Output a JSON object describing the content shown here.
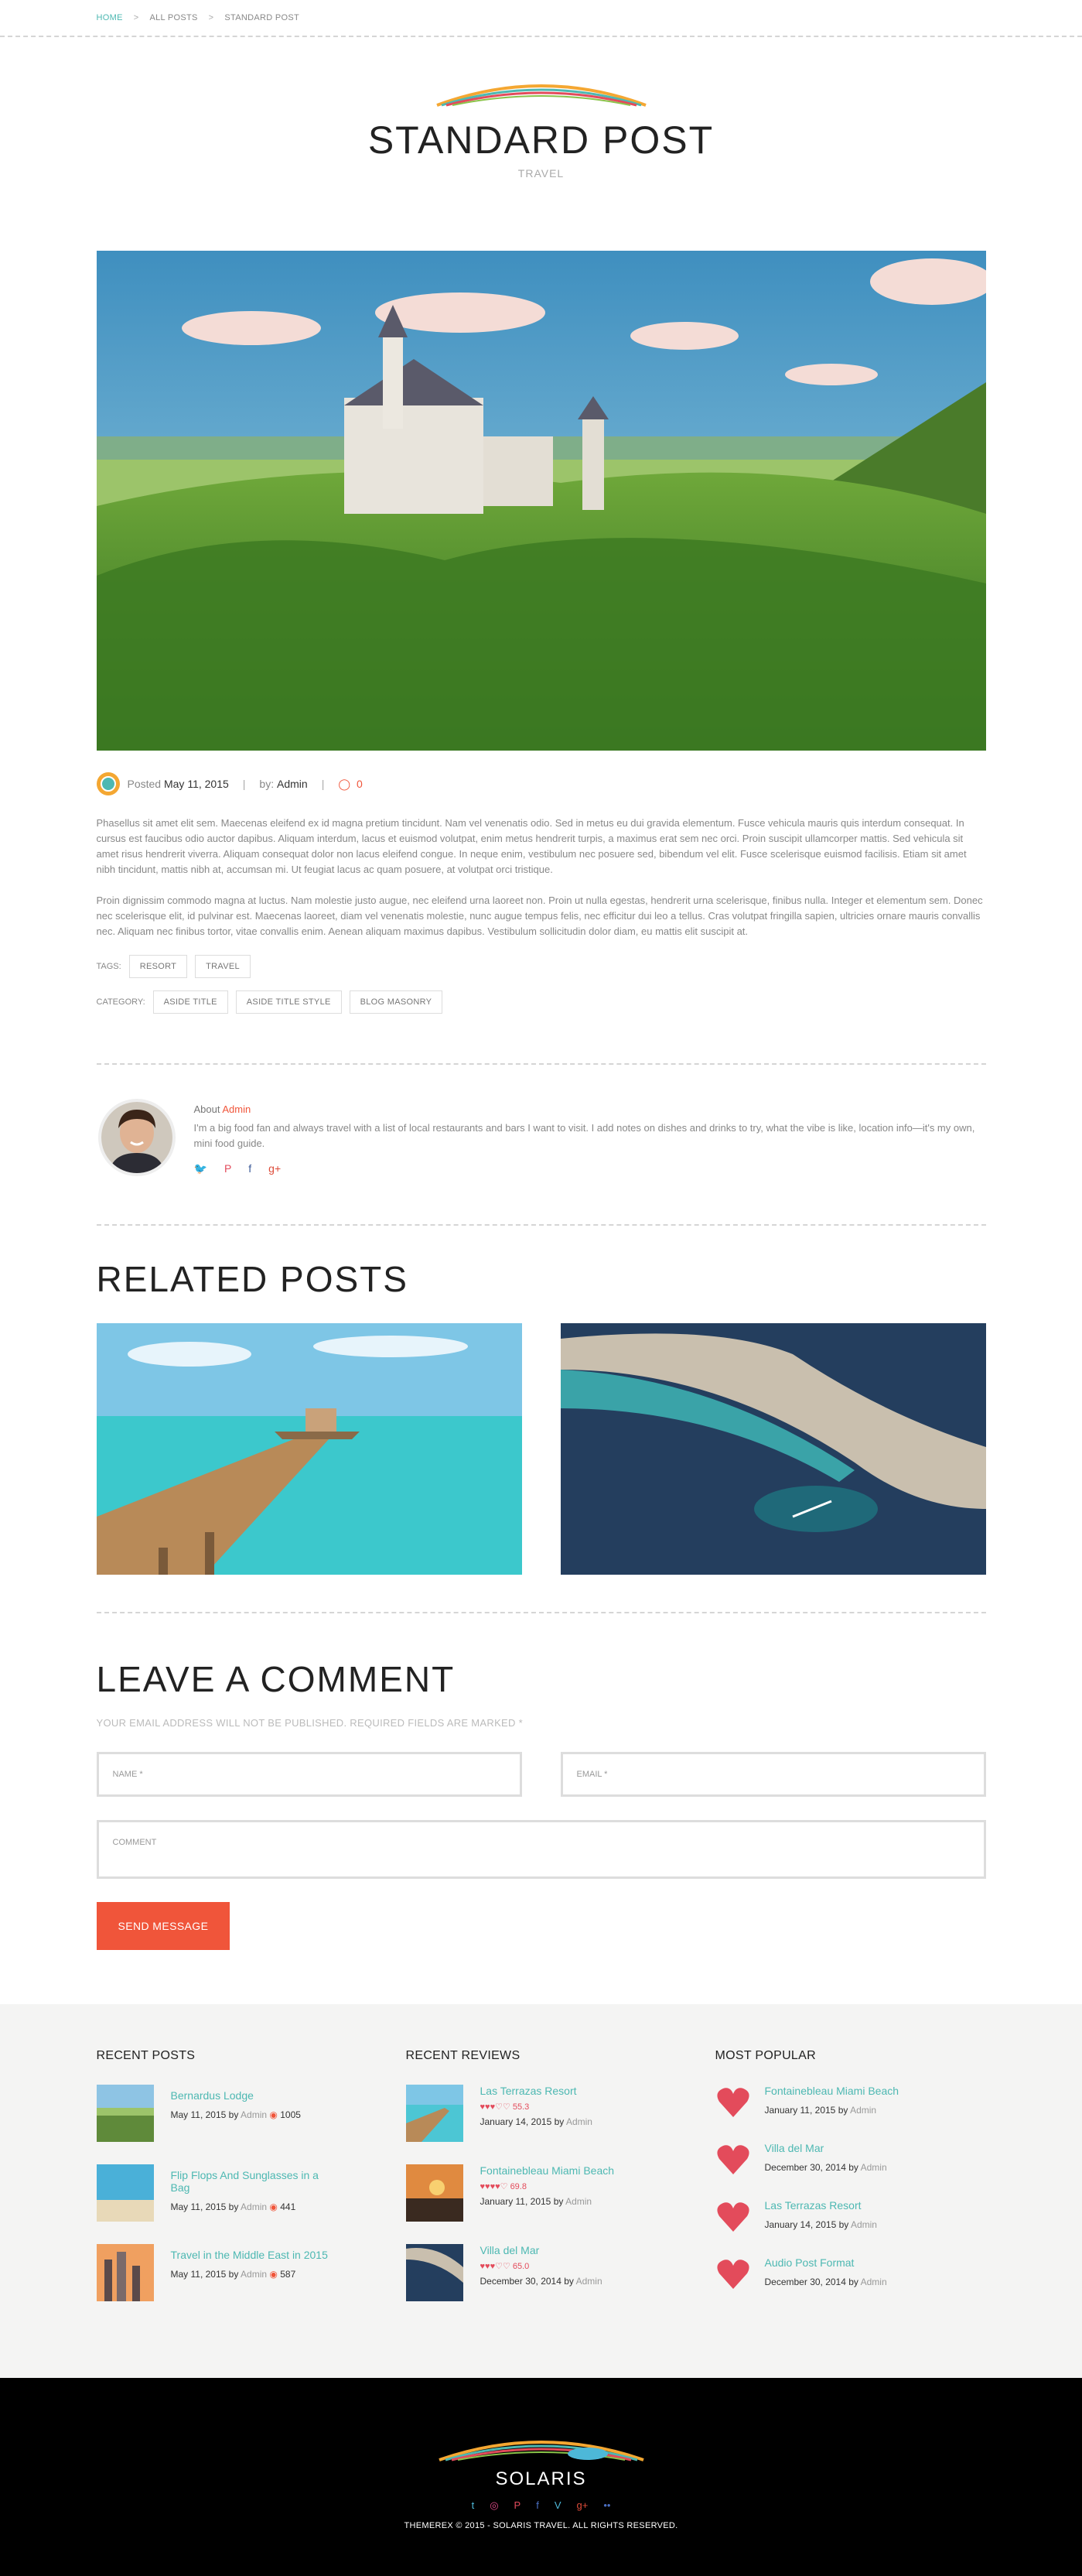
{
  "breadcrumb": {
    "home": "HOME",
    "sep1": ">",
    "all_posts": "ALL POSTS",
    "sep2": ">",
    "current": "STANDARD POST"
  },
  "post": {
    "title": "STANDARD POST",
    "category": "TRAVEL",
    "posted_label": "Posted",
    "date": "May 11, 2015",
    "by_label": "by:",
    "author": "Admin",
    "comments": "0",
    "separator": "|",
    "paragraphs": [
      "Phasellus sit amet elit sem. Maecenas eleifend ex id magna pretium tincidunt. Nam vel venenatis odio. Sed in metus eu dui gravida elementum. Fusce vehicula mauris quis interdum consequat. In cursus est faucibus odio auctor dapibus. Aliquam interdum, lacus et euismod volutpat, enim metus hendrerit turpis, a maximus erat sem nec orci. Proin suscipit ullamcorper mattis. Sed vehicula sit amet risus hendrerit viverra. Aliquam consequat dolor non lacus eleifend congue. In neque enim, vestibulum nec posuere sed, bibendum vel elit. Fusce scelerisque euismod facilisis. Etiam sit amet nibh tincidunt, mattis nibh at, accumsan mi. Ut feugiat lacus ac quam posuere, at volutpat orci tristique.",
      "Proin dignissim commodo magna at luctus. Nam molestie justo augue, nec eleifend urna laoreet non. Proin ut nulla egestas, hendrerit urna scelerisque, finibus nulla. Integer et elementum sem. Donec nec scelerisque elit, id pulvinar est. Maecenas laoreet, diam vel venenatis molestie, nunc augue tempus felis, nec efficitur dui leo a tellus. Cras volutpat fringilla sapien, ultricies ornare mauris convallis nec. Aliquam nec finibus tortor, vitae convallis enim. Aenean aliquam maximus dapibus. Vestibulum sollicitudin dolor diam, eu mattis elit suscipit at."
    ],
    "tags_label": "TAGS:",
    "tags": [
      "RESORT",
      "TRAVEL"
    ],
    "category_label": "CATEGORY:",
    "categories": [
      "ASIDE TITLE",
      "ASIDE TITLE STYLE",
      "BLOG MASONRY"
    ]
  },
  "author_box": {
    "about_label": "About",
    "name": "Admin",
    "bio": "I'm a big food fan and always travel with a list of local restaurants and bars I want to visit. I add notes on dishes and drinks to try, what the vibe is like, location info—it's my own, mini food guide.",
    "social": [
      {
        "icon": "twitter-icon",
        "glyph": "🐦",
        "color": "#4db8d8"
      },
      {
        "icon": "pinterest-icon",
        "glyph": "P",
        "color": "#e34b5b"
      },
      {
        "icon": "facebook-icon",
        "glyph": "f",
        "color": "#3b5998"
      },
      {
        "icon": "google-plus-icon",
        "glyph": "g+",
        "color": "#dd4b39"
      }
    ]
  },
  "related": {
    "heading": "RELATED POSTS"
  },
  "comment_form": {
    "heading": "LEAVE A COMMENT",
    "note": "YOUR EMAIL ADDRESS WILL NOT BE PUBLISHED. REQUIRED FIELDS ARE MARKED *",
    "name_placeholder": "NAME *",
    "email_placeholder": "EMAIL *",
    "comment_placeholder": "COMMENT",
    "submit": "SEND MESSAGE"
  },
  "widgets": {
    "recent_posts": {
      "title": "RECENT POSTS",
      "items": [
        {
          "title": "Bernardus Lodge",
          "date": "May 11, 2015",
          "by": "by",
          "author": "Admin",
          "views": "1005"
        },
        {
          "title": "Flip Flops And Sunglasses in a Bag",
          "date": "May 11, 2015",
          "by": "by",
          "author": "Admin",
          "views": "441"
        },
        {
          "title": "Travel in the Middle East in 2015",
          "date": "May 11, 2015",
          "by": "by",
          "author": "Admin",
          "views": "587"
        }
      ]
    },
    "recent_reviews": {
      "title": "RECENT REVIEWS",
      "items": [
        {
          "title": "Las Terrazas Resort",
          "stars": "♥♥♥♡♡",
          "score": "55.3",
          "rating": 55.3,
          "date": "January 14, 2015",
          "by": "by",
          "author": "Admin"
        },
        {
          "title": "Fontainebleau Miami Beach",
          "stars": "♥♥♥♥♡",
          "score": "69.8",
          "rating": 69.8,
          "date": "January 11, 2015",
          "by": "by",
          "author": "Admin"
        },
        {
          "title": "Villa del Mar",
          "stars": "♥♥♥♡♡",
          "score": "65.0",
          "rating": 65.0,
          "date": "December 30, 2014",
          "by": "by",
          "author": "Admin"
        }
      ]
    },
    "most_popular": {
      "title": "MOST POPULAR",
      "items": [
        {
          "title": "Fontainebleau Miami Beach",
          "date": "January 11, 2015",
          "by": "by",
          "author": "Admin"
        },
        {
          "title": "Villa del Mar",
          "date": "December 30, 2014",
          "by": "by",
          "author": "Admin"
        },
        {
          "title": "Las Terrazas Resort",
          "date": "January 14, 2015",
          "by": "by",
          "author": "Admin"
        },
        {
          "title": "Audio Post Format",
          "date": "December 30, 2014",
          "by": "by",
          "author": "Admin"
        }
      ]
    }
  },
  "footer": {
    "brand": "SOLARIS",
    "copyright": "THEMEREX © 2015 - SOLARIS TRAVEL. ALL RIGHTS RESERVED.",
    "social": [
      {
        "icon": "twitter-icon",
        "glyph": "t",
        "color": "#4db8d8"
      },
      {
        "icon": "dribbble-icon",
        "glyph": "◎",
        "color": "#e34b8b"
      },
      {
        "icon": "pinterest-icon",
        "glyph": "P",
        "color": "#e34b5b"
      },
      {
        "icon": "facebook-icon",
        "glyph": "f",
        "color": "#4b6fc2"
      },
      {
        "icon": "vimeo-icon",
        "glyph": "V",
        "color": "#4db8d8"
      },
      {
        "icon": "google-plus-icon",
        "glyph": "g+",
        "color": "#dd4b39"
      },
      {
        "icon": "flickr-icon",
        "glyph": "••",
        "color": "#4b6fc2"
      }
    ]
  },
  "colors": {
    "accent_teal": "#4db8b2",
    "accent_red": "#f0553a",
    "heart": "#e34b5b"
  }
}
